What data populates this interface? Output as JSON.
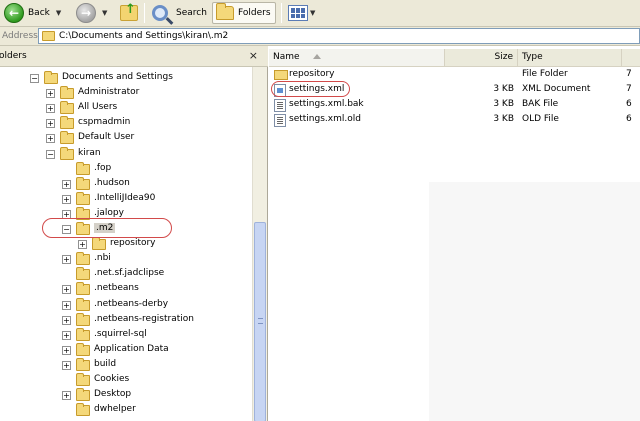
{
  "toolbar": {
    "back_label": "Back",
    "search_label": "Search",
    "folders_label": "Folders"
  },
  "address": {
    "label": "Address",
    "path": "C:\\Documents and Settings\\kiran\\.m2"
  },
  "folders_pane": {
    "title": "olders",
    "close": "×",
    "tree": [
      {
        "label": "Documents and Settings",
        "expander": "−"
      },
      {
        "label": "Administrator",
        "expander": "+"
      },
      {
        "label": "All Users",
        "expander": "+"
      },
      {
        "label": "cspmadmin",
        "expander": "+"
      },
      {
        "label": "Default User",
        "expander": "+"
      },
      {
        "label": "kiran",
        "expander": "−"
      },
      {
        "label": ".fop",
        "expander": ""
      },
      {
        "label": ".hudson",
        "expander": "+"
      },
      {
        "label": ".IntelliJIdea90",
        "expander": "+"
      },
      {
        "label": ".jalopy",
        "expander": "+"
      },
      {
        "label": ".m2",
        "expander": "−"
      },
      {
        "label": "repository",
        "expander": "+"
      },
      {
        "label": ".nbi",
        "expander": "+"
      },
      {
        "label": ".net.sf.jadclipse",
        "expander": ""
      },
      {
        "label": ".netbeans",
        "expander": "+"
      },
      {
        "label": ".netbeans-derby",
        "expander": "+"
      },
      {
        "label": ".netbeans-registration",
        "expander": "+"
      },
      {
        "label": ".squirrel-sql",
        "expander": "+"
      },
      {
        "label": "Application Data",
        "expander": "+"
      },
      {
        "label": "build",
        "expander": "+"
      },
      {
        "label": "Cookies",
        "expander": ""
      },
      {
        "label": "Desktop",
        "expander": "+"
      },
      {
        "label": "dwhelper",
        "expander": ""
      }
    ]
  },
  "file_list": {
    "columns": {
      "name": "Name",
      "size": "Size",
      "type": "Type"
    },
    "rows": [
      {
        "name": "repository",
        "size": "",
        "type": "File Folder",
        "extra": "7",
        "icon": "folder"
      },
      {
        "name": "settings.xml",
        "size": "3 KB",
        "type": "XML Document",
        "extra": "7",
        "icon": "xml"
      },
      {
        "name": "settings.xml.bak",
        "size": "3 KB",
        "type": "BAK File",
        "extra": "6",
        "icon": "txt"
      },
      {
        "name": "settings.xml.old",
        "size": "3 KB",
        "type": "OLD File",
        "extra": "6",
        "icon": "txt"
      }
    ]
  }
}
